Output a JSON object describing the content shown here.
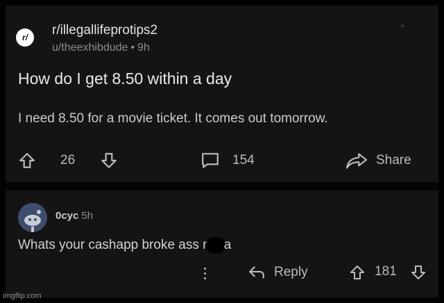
{
  "post": {
    "subreddit": "r/illegallifeprotips2",
    "subreddit_icon_text": "r/",
    "author": "u/theexhibdude",
    "age": "9h",
    "title": "How do I get 8.50 within a day",
    "body": "I need 8.50 for a movie ticket.  It comes out tomorrow.",
    "upvotes": "26",
    "comments": "154",
    "share_label": "Share"
  },
  "comment": {
    "user": "0cyc",
    "age": "5h",
    "text_before": "Whats your cashapp broke ass n",
    "text_after": "a",
    "reply_label": "Reply",
    "votes": "181"
  },
  "watermark": "imgflip.com",
  "colors": {
    "background": "#141414",
    "text": "#d7dadc",
    "muted": "#8b8e90"
  }
}
